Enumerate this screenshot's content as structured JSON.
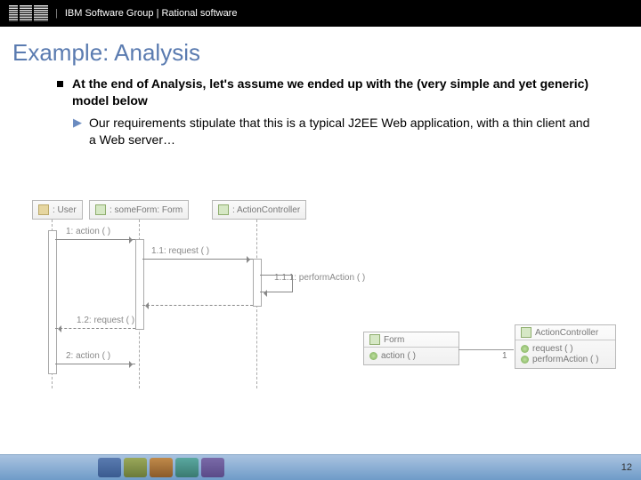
{
  "header": {
    "brand": "IBM",
    "group": "IBM Software Group | Rational software"
  },
  "title": "Example: Analysis",
  "bullets": {
    "main": "At the end of Analysis, let's assume we ended up with the (very simple and yet generic) model below",
    "sub": "Our requirements stipulate that this is a typical J2EE Web application, with a thin client and a Web server…"
  },
  "sequence": {
    "lifelines": {
      "user": ": User",
      "form": ": someForm: Form",
      "ctrl": ": ActionController"
    },
    "messages": {
      "m1": "1: action ( )",
      "m11": "1.1: request ( )",
      "m111": "1.1.1: performAction ( )",
      "m12": "1.2: request ( )",
      "m2": "2: action ( )"
    }
  },
  "classes": {
    "form": {
      "name": "Form",
      "ops": [
        "action ( )"
      ]
    },
    "ctrl": {
      "name": "ActionController",
      "ops": [
        "request ( )",
        "performAction ( )"
      ]
    },
    "assoc": "1"
  },
  "page": "12"
}
